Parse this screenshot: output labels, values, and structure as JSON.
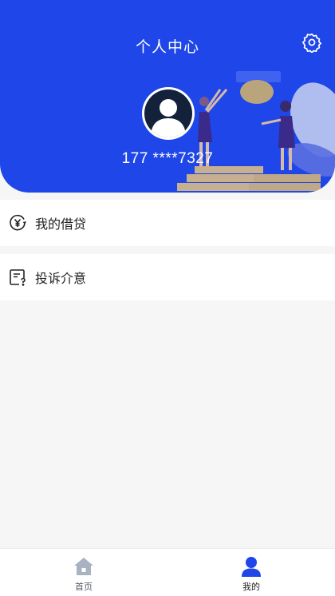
{
  "header": {
    "title": "个人中心",
    "phone": "177 ****7327",
    "background_color": "#1f46e8",
    "settings_icon": "gear-icon",
    "avatar_icon": "user-avatar-icon"
  },
  "menu": [
    {
      "label": "我的借贷",
      "icon": "yen-coin-icon"
    },
    {
      "label": "投诉介意",
      "icon": "feedback-document-icon"
    }
  ],
  "tabbar": {
    "items": [
      {
        "label": "首页",
        "icon": "home-icon",
        "active": false,
        "color": "#a9b2c3"
      },
      {
        "label": "我的",
        "icon": "user-icon",
        "active": true,
        "color": "#1f46e8"
      }
    ]
  }
}
